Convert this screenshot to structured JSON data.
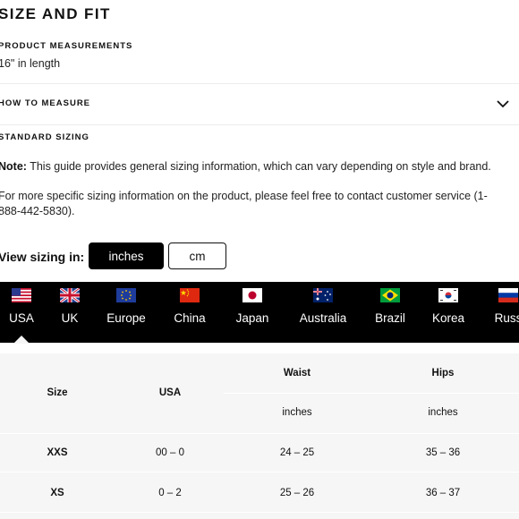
{
  "section_title": "SIZE AND FIT",
  "product_measurements": {
    "heading": "PRODUCT MEASUREMENTS",
    "value": "16\" in length"
  },
  "how_to_measure": {
    "heading": "HOW TO MEASURE"
  },
  "standard_sizing": {
    "heading": "STANDARD SIZING",
    "note_label": "Note:",
    "note_text": " This guide provides general sizing information, which can vary depending on style and brand.",
    "info_text": "For more specific sizing information on the product, please feel free to contact customer service (1-888-442-5830)."
  },
  "view_sizing": {
    "label": "View sizing in:",
    "options": [
      "inches",
      "cm"
    ],
    "selected": "inches"
  },
  "countries": [
    {
      "label": "USA",
      "flag": "us-flag-icon"
    },
    {
      "label": "UK",
      "flag": "uk-flag-icon"
    },
    {
      "label": "Europe",
      "flag": "eu-flag-icon"
    },
    {
      "label": "China",
      "flag": "china-flag-icon"
    },
    {
      "label": "Japan",
      "flag": "japan-flag-icon"
    },
    {
      "label": "Australia",
      "flag": "australia-flag-icon"
    },
    {
      "label": "Brazil",
      "flag": "brazil-flag-icon"
    },
    {
      "label": "Korea",
      "flag": "korea-flag-icon"
    },
    {
      "label": "Russ",
      "flag": "russia-flag-icon"
    }
  ],
  "selected_country": "USA",
  "size_table": {
    "headers": {
      "size": "Size",
      "region": "USA",
      "waist": "Waist",
      "hips": "Hips",
      "waist_unit": "inches",
      "hips_unit": "inches"
    },
    "rows": [
      {
        "size": "XXS",
        "region": "00 – 0",
        "waist": "24 – 25",
        "hips": "35 – 36"
      },
      {
        "size": "XS",
        "region": "0 – 2",
        "waist": "25 – 26",
        "hips": "36 – 37"
      }
    ]
  }
}
